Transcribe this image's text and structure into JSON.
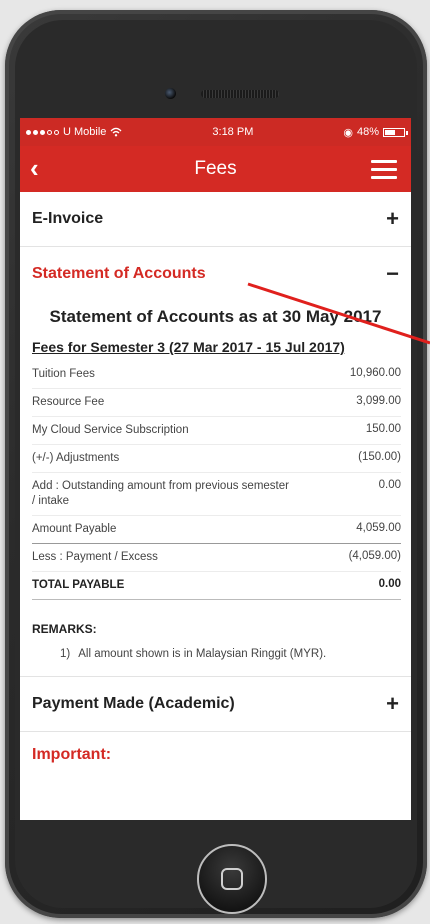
{
  "status_bar": {
    "carrier": "U Mobile",
    "time": "3:18 PM",
    "battery": "48%"
  },
  "navbar": {
    "back_icon": "‹",
    "title": "Fees"
  },
  "sections": {
    "einvoice": {
      "title": "E-Invoice",
      "toggle": "+"
    },
    "statement": {
      "title": "Statement of Accounts",
      "toggle": "−"
    },
    "payment": {
      "title": "Payment Made (Academic)",
      "toggle": "+"
    },
    "important": {
      "title": "Important:"
    }
  },
  "statement": {
    "heading": "Statement of Accounts as at 30 May 2017",
    "semester": "Fees for Semester 3 (27 Mar 2017 - 15 Jul 2017)",
    "rows": [
      {
        "label": "Tuition Fees",
        "amount": "10,960.00"
      },
      {
        "label": "Resource Fee",
        "amount": "3,099.00"
      },
      {
        "label": "My Cloud Service Subscription",
        "amount": "150.00"
      },
      {
        "label": "(+/-) Adjustments",
        "amount": "(150.00)"
      },
      {
        "label": "Add : Outstanding amount from previous semester / intake",
        "amount": "0.00"
      },
      {
        "label": "Amount Payable",
        "amount": "4,059.00"
      },
      {
        "label": "Less : Payment / Excess",
        "amount": "(4,059.00)"
      },
      {
        "label": "TOTAL PAYABLE",
        "amount": "0.00"
      }
    ],
    "remarks_title": "REMARKS:",
    "remark_num": "1)",
    "remark_text": "All amount shown is in Malaysian Ringgit (MYR)."
  },
  "colors": {
    "accent": "#d42a24",
    "status_bar": "#cc2a24",
    "annotation_arrow": "#e0201d"
  }
}
